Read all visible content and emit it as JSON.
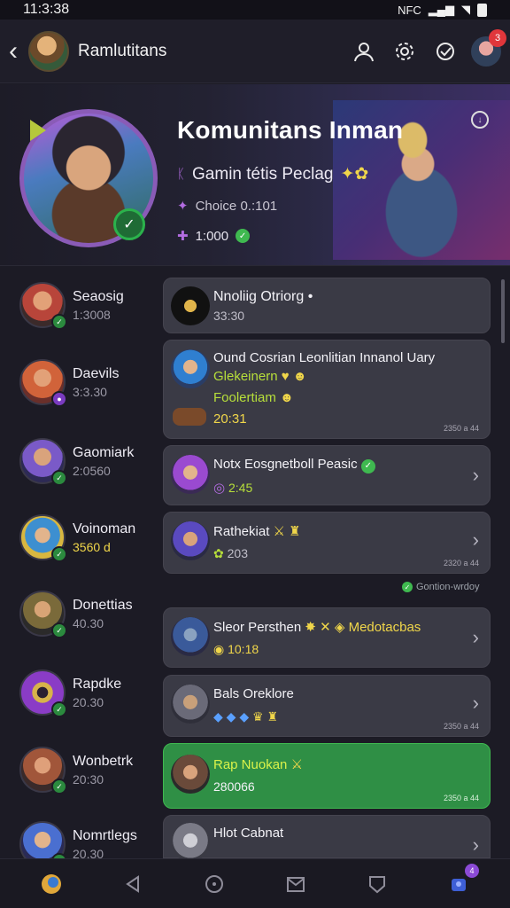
{
  "status": {
    "time": "11:3:38",
    "nfc": "NFC"
  },
  "topbar": {
    "title": "Ramlutitans",
    "notif_count": "3"
  },
  "hero": {
    "title": "Komunitans Inman",
    "line1": "Gamin tétis Peclag",
    "line2": "Choice 0.:101",
    "line3": "1:000"
  },
  "contacts": [
    {
      "name": "Seaosig",
      "time": "1:3008",
      "colors": [
        "#b8453a",
        "#3b2a2a"
      ]
    },
    {
      "name": "Daevils",
      "time": "3:3.30",
      "colors": [
        "#d1633a",
        "#6a2f2a"
      ]
    },
    {
      "name": "Gaomiark",
      "time": "2:0560",
      "colors": [
        "#7a5ac8",
        "#2d2a55"
      ]
    },
    {
      "name": "Voinoman",
      "time": "3560 d",
      "colors": [
        "#3d8fd0",
        "#d8b740"
      ]
    },
    {
      "name": "Donettias",
      "time": "40.30",
      "colors": [
        "#7a6a3a",
        "#2b2a2a"
      ]
    },
    {
      "name": "Rapdke",
      "time": "20.30",
      "colors": [
        "#8a3cc6",
        "#d7b34a"
      ]
    },
    {
      "name": "Wonbetrk",
      "time": "20:30",
      "colors": [
        "#a1563a",
        "#3a2a2a"
      ]
    },
    {
      "name": "Nomrtlegs",
      "time": "20.30",
      "colors": [
        "#4a6fd0",
        "#2a2a55"
      ]
    }
  ],
  "cards": [
    {
      "title": "Nnoliig Otriorg",
      "sub": "33:30"
    },
    {
      "title": "Ound Cosrian Leonlitian Innanol Uary",
      "sub1": "Glekeinern",
      "sub2": "Foolertiam",
      "sub3": "20:31",
      "ts": "2350 a 44"
    },
    {
      "title": "Notx Eosgnetboll Peasic",
      "sub": "2:45"
    },
    {
      "title": "Rathekiat",
      "sub": "203",
      "ts": "2320 a 44"
    },
    {
      "title": "Sleor Persthen",
      "extra": "Medotacbas",
      "sub": "10:18"
    },
    {
      "title": "Bals Oreklore",
      "ts": "2350 a 44"
    },
    {
      "title": "Rap Nuokan",
      "sub": "280066",
      "ts": "2350 a 44"
    },
    {
      "title": "Hlot Cabnat"
    }
  ],
  "group_note": "Gontion-wrdoy",
  "bottom": {
    "badge": "4"
  }
}
